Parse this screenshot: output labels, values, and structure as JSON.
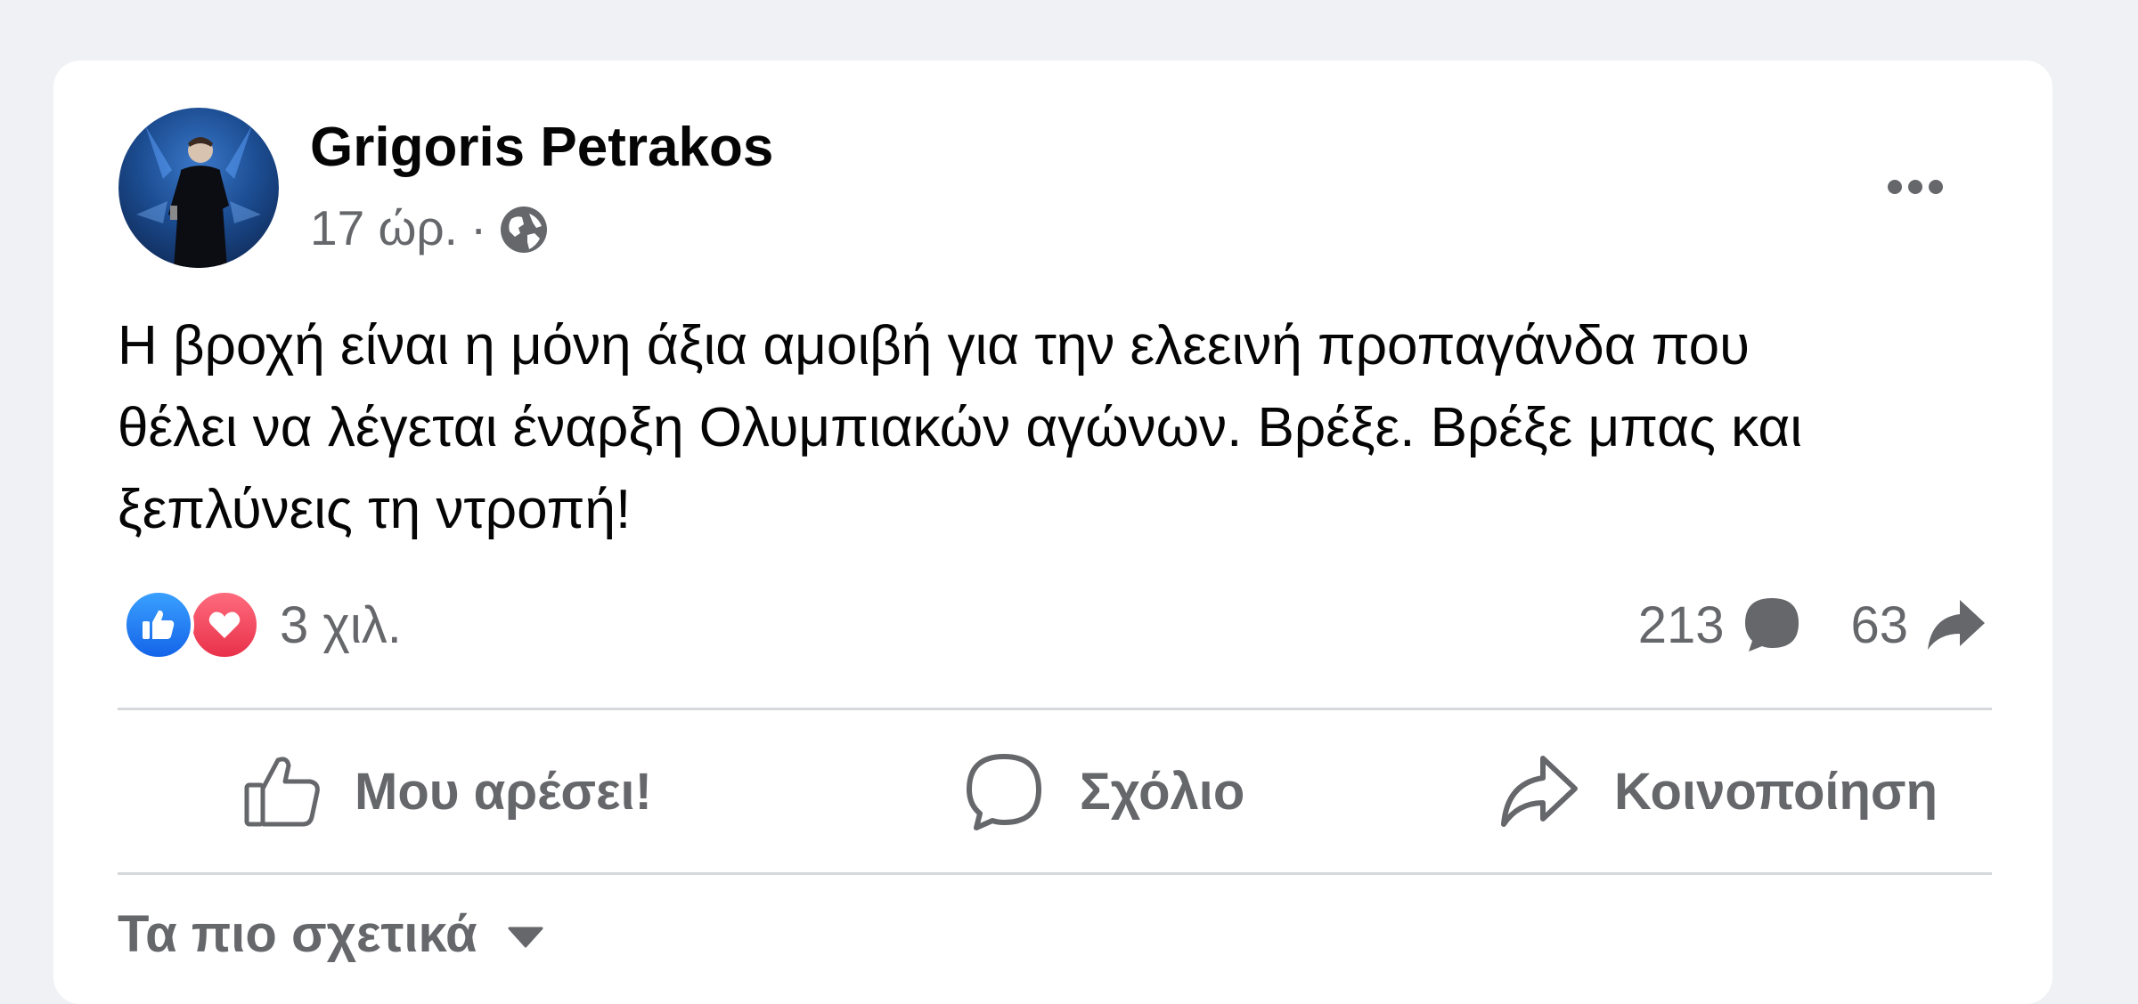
{
  "post": {
    "author": "Grigoris Petrakos",
    "time": "17 ώρ.",
    "separator": "·",
    "privacy_icon": "globe-icon",
    "text": "Η βροχή είναι η μόνη άξια αμοιβή για την ελεεινή προπαγάνδα που\nθέλει να λέγεται έναρξη Ολυμπιακών αγώνων. Βρέξε. Βρέξε μπας και\nξεπλύνεις τη ντροπή!"
  },
  "reactions": {
    "icons": [
      "like-reaction-icon",
      "love-reaction-icon"
    ],
    "count": "3 χιλ."
  },
  "stats": {
    "comments": "213",
    "shares": "63"
  },
  "actions": {
    "like": "Μου αρέσει!",
    "comment": "Σχόλιο",
    "share": "Κοινοποίηση"
  },
  "comments_sort": {
    "label": "Τα πιο σχετικά"
  },
  "colors": {
    "background": "#f0f1f4",
    "card": "#ffffff",
    "text_primary": "#050505",
    "text_secondary": "#65676b",
    "like_blue": "#1877f2",
    "love_red": "#f33e58",
    "divider": "#d6d8dc"
  }
}
